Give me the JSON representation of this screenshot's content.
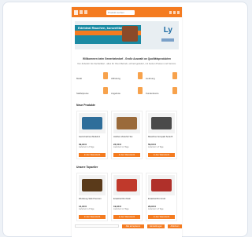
{
  "header": {
    "search_placeholder": "Produkt suchen"
  },
  "banner": {
    "headline": "Edeldeal Rauchen, kurzzeitbefristet",
    "brand": "Ly"
  },
  "intro": {
    "heading": "Willkommen beim Gewerbebedarf - Große Auswahl an Qualitätsprodukten",
    "text": "Von Zubehör bis Fachartikel - alles für Ihren Betrieb, schnell geliefert, mit besten Preisen und Service."
  },
  "features": [
    {
      "label": "Markt"
    },
    {
      "label": "Abholung"
    },
    {
      "label": "Lieferung"
    },
    {
      "label": "Staffelpreise"
    },
    {
      "label": "Angebote"
    },
    {
      "label": "Kundenkonto"
    }
  ],
  "sections": [
    {
      "title": "Neue Produkte",
      "products": [
        {
          "name": "Gerät Fachset Modell A",
          "price": "39,90 €",
          "stock": "Lieferzeit 1-3 Tage",
          "button": "In den Warenkorb",
          "color": "#2f6e9a"
        },
        {
          "name": "Holzbox Zubehör Set",
          "price": "24,50 €",
          "stock": "Lieferzeit 1-3 Tage",
          "button": "In den Warenkorb",
          "color": "#9a6a3a"
        },
        {
          "name": "Maschine Kompakt Serie B",
          "price": "59,00 €",
          "stock": "Lieferzeit 1-3 Tage",
          "button": "In den Warenkorb",
          "color": "#4a4a4a"
        }
      ]
    },
    {
      "title": "Unsere Topseller",
      "products": [
        {
          "name": "Werkzeug Stab Premium",
          "price": "14,90 €",
          "stock": "Lieferzeit 1-3 Tage",
          "button": "In den Warenkorb",
          "color": "#5a3a1a"
        },
        {
          "name": "Ersatzteil Rot Klein",
          "price": "19,90 €",
          "stock": "Lieferzeit 1-3 Tage",
          "button": "In den Warenkorb",
          "color": "#c0392b"
        },
        {
          "name": "Ersatzteil Rot Groß",
          "price": "29,90 €",
          "stock": "Lieferzeit 1-3 Tage",
          "button": "In den Warenkorb",
          "color": "#b0302a"
        }
      ]
    }
  ],
  "footer": {
    "btn_1": "Alle akzeptieren",
    "btn_2": "Einstellungen",
    "btn_3": "Ablehnen"
  }
}
